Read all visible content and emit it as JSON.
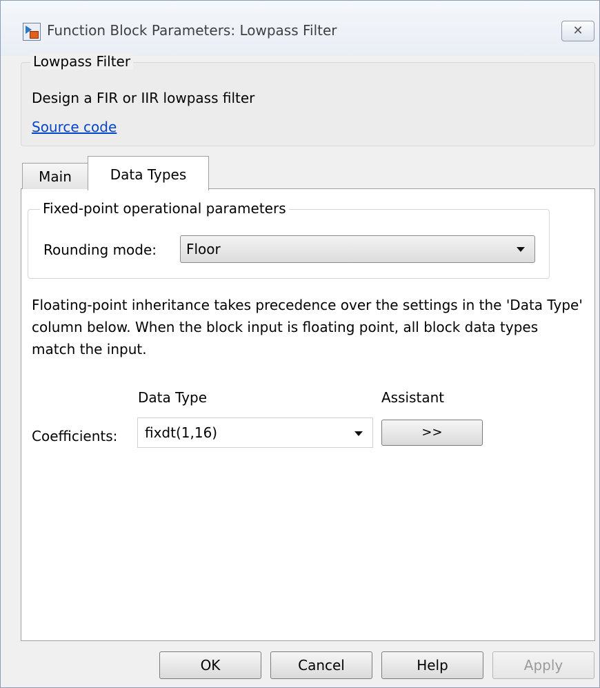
{
  "window": {
    "title": "Function Block Parameters: Lowpass Filter",
    "close_glyph": "✕"
  },
  "description": {
    "group_title": "Lowpass Filter",
    "text": "Design a FIR or IIR lowpass filter",
    "link": "Source code"
  },
  "tabs": [
    {
      "label": "Main",
      "active": false
    },
    {
      "label": "Data Types",
      "active": true
    }
  ],
  "fixed_point": {
    "group_title": "Fixed-point operational parameters",
    "rounding_label": "Rounding mode:",
    "rounding_value": "Floor"
  },
  "info_text": "Floating-point inheritance takes precedence over the settings in the 'Data Type' column below. When the block input is floating point, all block data types match the input.",
  "table": {
    "col_data_type": "Data Type",
    "col_assistant": "Assistant",
    "rows": [
      {
        "label": "Coefficients:",
        "data_type": "fixdt(1,16)",
        "assistant_label": ">>"
      }
    ]
  },
  "buttons": {
    "ok": "OK",
    "cancel": "Cancel",
    "help": "Help",
    "apply": "Apply"
  },
  "icons": [
    "simulink-block-icon",
    "close-icon",
    "chevron-down-icon"
  ]
}
